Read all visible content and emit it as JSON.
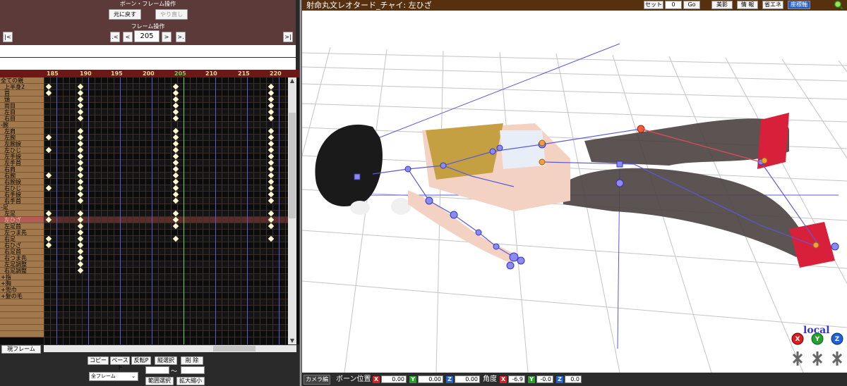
{
  "bone_frame": {
    "title": "ボーン・フレーム操作",
    "undo_label": "元に戻す",
    "redo_label": "やり直し",
    "frame_op_title": "フレーム操作",
    "nav": {
      "first": "|<",
      "prev_key": ".<",
      "prev": "<",
      "frame": "205",
      "next": ">",
      "next_key": ">.",
      "last": ">|"
    }
  },
  "timeline": {
    "ticks": [
      "185",
      "190",
      "195",
      "200",
      "205",
      "210",
      "215",
      "220"
    ],
    "current_tick": "205",
    "bones": [
      {
        "label": "全ての親",
        "group": true
      },
      {
        "label": "上半身2"
      },
      {
        "label": "首"
      },
      {
        "label": "頭"
      },
      {
        "label": "両目"
      },
      {
        "label": "左目"
      },
      {
        "label": "右目"
      },
      {
        "label": "-腕",
        "group": true
      },
      {
        "label": "左肩"
      },
      {
        "label": "左腕"
      },
      {
        "label": "左腕捩"
      },
      {
        "label": "左ひじ"
      },
      {
        "label": "左手捩"
      },
      {
        "label": "左手首"
      },
      {
        "label": "右肩"
      },
      {
        "label": "右腕"
      },
      {
        "label": "右腕捩"
      },
      {
        "label": "右ひじ"
      },
      {
        "label": "右手捩"
      },
      {
        "label": "右手首"
      },
      {
        "label": "-足",
        "group": true
      },
      {
        "label": "左足"
      },
      {
        "label": "左ひざ",
        "selected": true
      },
      {
        "label": "左足首"
      },
      {
        "label": "左つま先"
      },
      {
        "label": "右足"
      },
      {
        "label": "右ひざ"
      },
      {
        "label": "右足首"
      },
      {
        "label": "右つま先"
      },
      {
        "label": "左足調整"
      },
      {
        "label": "右足調整"
      },
      {
        "label": "+指",
        "group": true
      },
      {
        "label": "+胸",
        "group": true
      },
      {
        "label": "+兜巾",
        "group": true
      },
      {
        "label": "+髪の毛",
        "group": true
      },
      {
        "label": ""
      },
      {
        "label": ""
      },
      {
        "label": ""
      },
      {
        "label": ""
      },
      {
        "label": ""
      },
      {
        "label": ""
      }
    ]
  },
  "bottom_controls": {
    "current_frame_label": "現フレーム",
    "copy": "コピー",
    "paste": "ペースト",
    "invert_paste": "反転P",
    "vertical_select": "縦選択",
    "delete": "削 除",
    "range_select_value": "全フレーム",
    "range_tilde": "〜",
    "range_select_btn": "範囲選択",
    "scale": "拡大縮小"
  },
  "viewport": {
    "title": "射命丸文レオタード_チャイ: 左ひざ",
    "toolbar": {
      "set_label": "セット",
      "frame_value": "0",
      "go_label": "Go",
      "shadow_label": "影",
      "info_label": "情 報",
      "eco_label": "省エネ",
      "axis_label": "座標軸"
    },
    "local_label": "local",
    "axis_gizmo": {
      "x": "X",
      "y": "Y",
      "z": "Z"
    }
  },
  "status_bar": {
    "camera_edit": "カメラ編",
    "bone_position_label": "ボーン位置",
    "pos": {
      "x": "0.00",
      "y": "0.00",
      "z": "0.00"
    },
    "angle_label": "角度",
    "rot": {
      "x": "-6.9",
      "y": "-0.0",
      "z": "0.0"
    },
    "axis": {
      "x": "X",
      "y": "Y",
      "z": "Z"
    }
  },
  "colors": {
    "panel_brown": "#5b3a39",
    "header_red": "#6d1817",
    "bone_tan": "#a2794d",
    "selected_bone": "#b55b55",
    "key_color": "#fff9d2",
    "axis_blue": "#5a5ad8",
    "current_green": "#6fcf5f",
    "viewport_title": "#56300f",
    "axis_x": "#d82020",
    "axis_y": "#2aa02a",
    "axis_z": "#2060d8"
  }
}
